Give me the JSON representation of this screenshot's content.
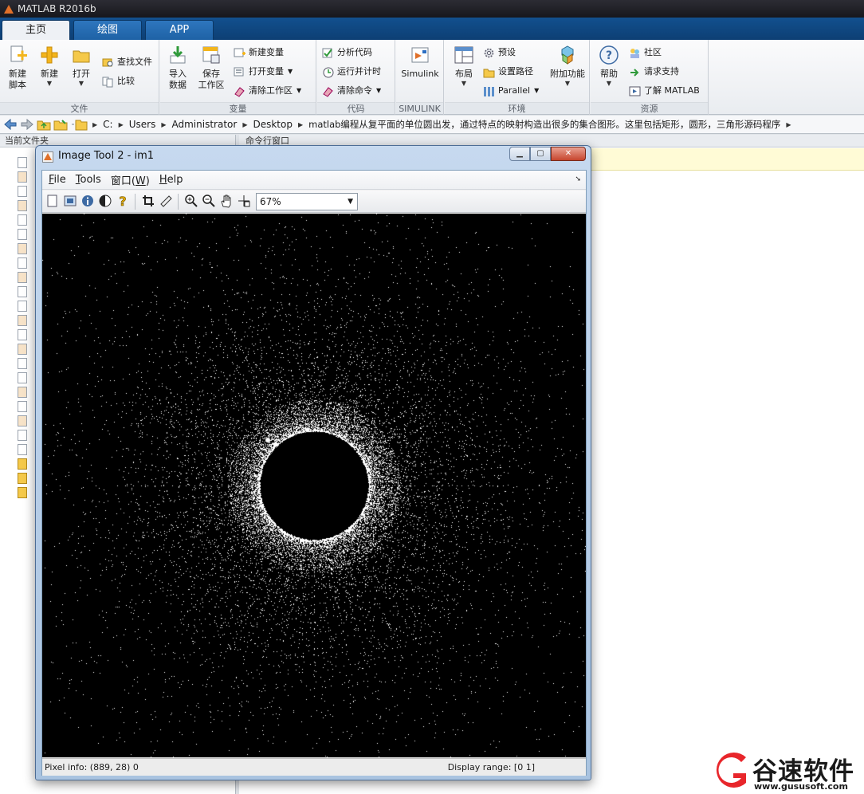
{
  "app": {
    "title": "MATLAB R2016b"
  },
  "tabs": [
    {
      "label": "主页",
      "active": true
    },
    {
      "label": "绘图",
      "active": false
    },
    {
      "label": "APP",
      "active": false
    }
  ],
  "ribbon": {
    "file": {
      "label": "文件",
      "new_script": "新建\n脚本",
      "new": "新建",
      "open": "打开",
      "find_files": "查找文件",
      "compare": "比较"
    },
    "variable": {
      "label": "变量",
      "import": "导入\n数据",
      "save": "保存\n工作区",
      "new_var": "新建变量",
      "open_var": "打开变量",
      "clear_ws": "清除工作区"
    },
    "code": {
      "label": "代码",
      "analyze": "分析代码",
      "run_time": "运行并计时",
      "clear_cmd": "清除命令"
    },
    "simulink": {
      "label": "SIMULINK",
      "simulink": "Simulink"
    },
    "env": {
      "label": "环境",
      "layout": "布局",
      "prefs": "预设",
      "set_path": "设置路径",
      "parallel": "Parallel",
      "addons": "附加功能"
    },
    "resources": {
      "label": "资源",
      "help": "帮助",
      "community": "社区",
      "support": "请求支持",
      "learn": "了解 MATLAB"
    }
  },
  "address": {
    "crumbs": [
      "C:",
      "Users",
      "Administrator",
      "Desktop",
      "matlab编程从复平面的单位圆出发，通过特点的映射构造出很多的集合图形。这里包括矩形，圆形，三角形源码程序"
    ]
  },
  "left_panel": {
    "title": "当前文件夹"
  },
  "right_panel": {
    "title": "命令行窗口"
  },
  "image_tool": {
    "title": "Image Tool 2 - im1",
    "menus": [
      {
        "label": "File",
        "u": "F",
        "rest": "ile"
      },
      {
        "label": "Tools",
        "u": "T",
        "rest": "ools"
      },
      {
        "label": "窗口(W)",
        "pre": "窗口(",
        "u": "W",
        "rest": ")"
      },
      {
        "label": "Help",
        "u": "H",
        "rest": "elp"
      }
    ],
    "zoom": "67%",
    "status": {
      "pixel_info": "Pixel info: (889, 28)  0",
      "display_range": "Display range: [0 1]"
    }
  },
  "watermark": {
    "text": "谷速软件",
    "url": "www.gususoft.com",
    "accent": "#e8262b"
  }
}
